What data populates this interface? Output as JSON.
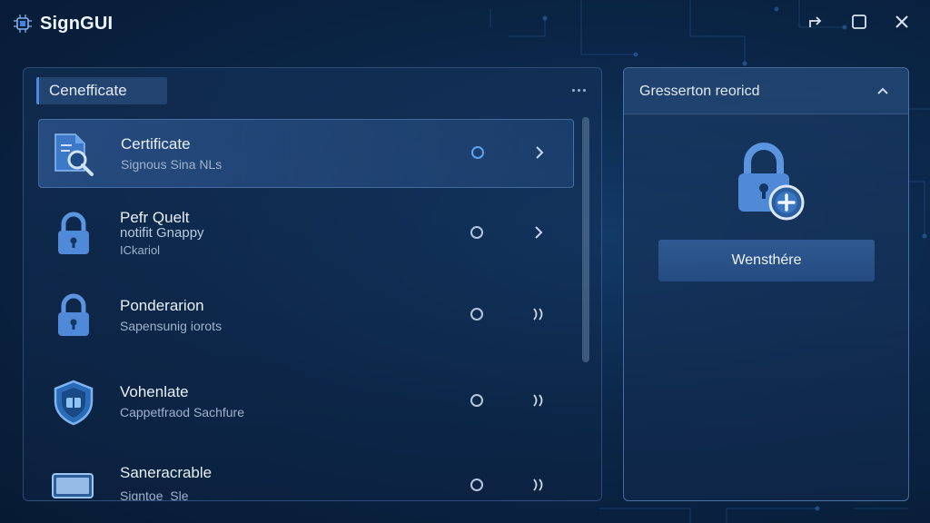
{
  "app": {
    "title": "SignGUI",
    "icon": "chip-icon"
  },
  "window_controls": {
    "share_icon": "share-icon",
    "maximize_icon": "maximize-icon",
    "close_icon": "close-icon"
  },
  "left_panel": {
    "tab_label": "Cenefficate",
    "more_icon": "more-horizontal-icon",
    "items": [
      {
        "title": "Certificate",
        "subtitle": "Signous Sina NLs",
        "icon": "certificate-search-icon",
        "selected": true,
        "chevron": "chevron-right-icon"
      },
      {
        "title": "Pefr Quelt",
        "title_line2": "notifit Gnappy",
        "subtitle": "ICkariol",
        "icon": "lock-icon",
        "selected": false,
        "chevron": "chevron-right-icon"
      },
      {
        "title": "Ponderarion",
        "subtitle": "Sapensunig iorots",
        "icon": "lock-icon",
        "selected": false,
        "chevron": "double-chevron-icon"
      },
      {
        "title": "Vohenlate",
        "subtitle": "Cappetfraod Sachfure",
        "icon": "shield-icon",
        "selected": false,
        "chevron": "double-chevron-icon"
      },
      {
        "title": "Saneracrable",
        "subtitle": "Signtoe_Sle",
        "icon": "card-icon",
        "selected": false,
        "chevron": "double-chevron-icon"
      }
    ]
  },
  "right_panel": {
    "title": "Gresserton reoricd",
    "collapse_icon": "chevron-up-icon",
    "lock_icon": "lock-add-icon",
    "button_label": "Wensthére"
  },
  "colors": {
    "background": "#0b2648",
    "accent": "#4a8be0",
    "icon_blue": "#5b95e0"
  }
}
